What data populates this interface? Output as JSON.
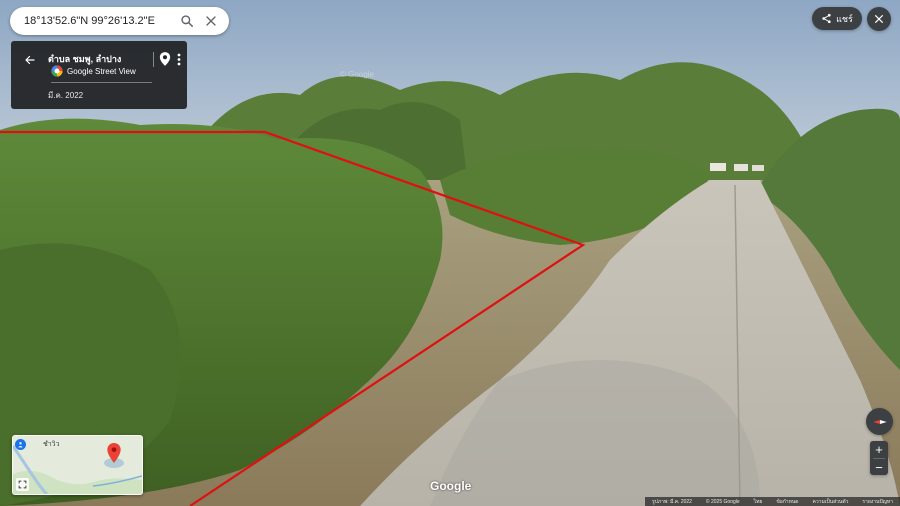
{
  "search": {
    "value": "18°13'52.6\"N 99°26'13.2\"E",
    "search_icon": "search-icon",
    "clear_icon": "close-icon"
  },
  "info_panel": {
    "title": "ตำบล ชมพู, ลำปาง",
    "brand": "Google Street View",
    "capture_date": "มี.ค. 2022"
  },
  "topright": {
    "share_label": "แชร์"
  },
  "watermark": "© Google",
  "minimap": {
    "label": "ชำวิว"
  },
  "zoom": {
    "in": "+",
    "out": "−"
  },
  "google_logo": "Google",
  "footer": {
    "items": [
      "รูปภาพ: มี.ค. 2022",
      "© 2025 Google",
      "ไทย",
      "ข้อกำหนด",
      "ความเป็นส่วนตัว",
      "รายงานปัญหา"
    ]
  },
  "colors": {
    "boundary_line": "#e01010",
    "panel_bg": "#202124",
    "accent": "#1a73e8",
    "pin": "#ea4335"
  }
}
